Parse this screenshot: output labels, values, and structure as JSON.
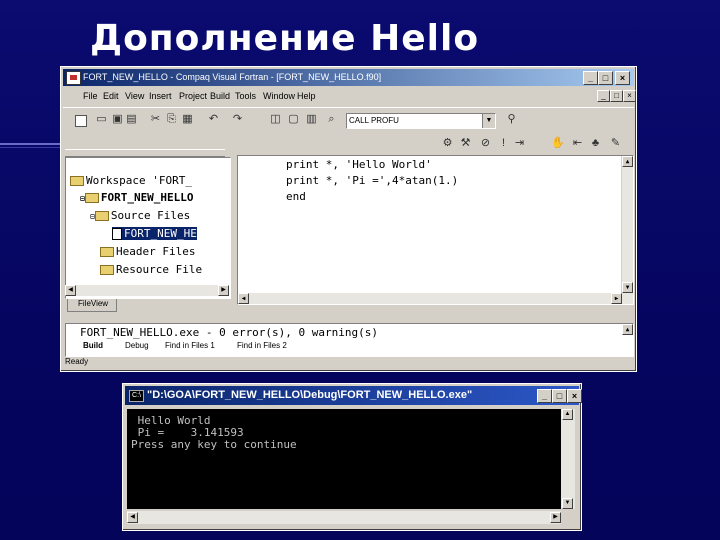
{
  "slide": {
    "title": "Дополнение Hello"
  },
  "ide": {
    "title": "FORT_NEW_HELLO - Compaq Visual Fortran - [FORT_NEW_HELLO.f90]",
    "menu": [
      "File",
      "Edit",
      "View",
      "Insert",
      "Project",
      "Build",
      "Tools",
      "Window",
      "Help"
    ],
    "combo_value": "CALL PROFU",
    "workspace": {
      "items": [
        "Workspace 'FORT_",
        "FORT_NEW_HELLO",
        "Source Files",
        "FORT_NEW_HE",
        "Header Files",
        "Resource File"
      ],
      "tab": "FileView"
    },
    "code": [
      "print *, 'Hello World'",
      "print *, 'Pi =',4*atan(1.)",
      "end"
    ],
    "output": {
      "line": "FORT_NEW_HELLO.exe - 0 error(s), 0 warning(s)",
      "tabs": [
        "Build",
        "Debug",
        "Find in Files 1",
        "Find in Files 2"
      ]
    },
    "status": "Ready"
  },
  "console": {
    "title": "\"D:\\GOA\\FORT_NEW_HELLO\\Debug\\FORT_NEW_HELLO.exe\"",
    "lines": [
      " Hello World",
      " Pi =    3.141593",
      "Press any key to continue"
    ]
  }
}
